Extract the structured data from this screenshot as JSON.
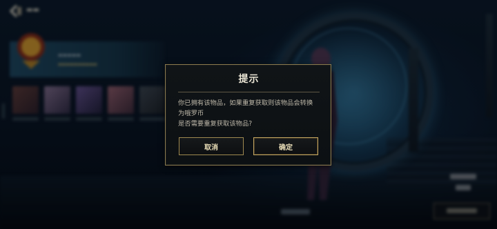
{
  "dialog": {
    "title": "提示",
    "message_lines": [
      "你已拥有该物品，如果重复获取则该物品会转换",
      "为哦罗币",
      "是否需要重复获取该物品?"
    ],
    "cancel_label": "取消",
    "confirm_label": "确定"
  },
  "colors": {
    "dialog_border": "#8a7a4e",
    "button_border": "#a08a50",
    "title_text": "#ece7d6",
    "body_text": "#bdb7a8"
  },
  "icons": {
    "back": "back-chevron-icon"
  }
}
